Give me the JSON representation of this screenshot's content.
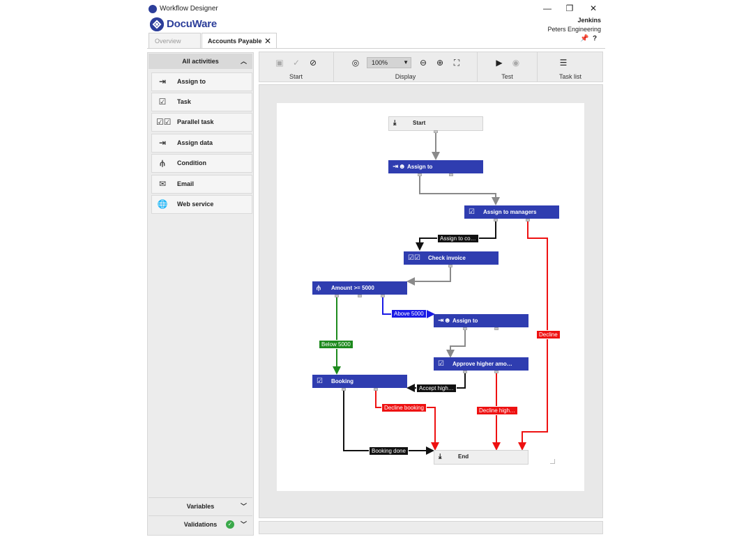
{
  "window": {
    "app_title": "Workflow Designer",
    "brand": "DocuWare",
    "user_name": "Jenkins",
    "user_org": "Peters Engineering",
    "controls": {
      "minimize": "—",
      "restore": "❐",
      "close": "✕"
    },
    "header_icons": {
      "pin": "📌",
      "help": "?"
    }
  },
  "tabs": [
    {
      "label": "Overview",
      "active": false
    },
    {
      "label": "Accounts Payable",
      "active": true
    }
  ],
  "sidebar": {
    "section_title": "All activities",
    "activities": [
      {
        "label": "Assign to",
        "icon": "assign-to-icon"
      },
      {
        "label": "Task",
        "icon": "task-icon"
      },
      {
        "label": "Parallel task",
        "icon": "parallel-task-icon"
      },
      {
        "label": "Assign data",
        "icon": "assign-data-icon"
      },
      {
        "label": "Condition",
        "icon": "condition-icon"
      },
      {
        "label": "Email",
        "icon": "email-icon"
      },
      {
        "label": "Web service",
        "icon": "web-service-icon"
      }
    ],
    "variables_label": "Variables",
    "validations_label": "Validations",
    "validations_status": "ok"
  },
  "toolbar": {
    "groups": [
      {
        "label": "Start"
      },
      {
        "label": "Display"
      },
      {
        "label": "Test"
      },
      {
        "label": "Task list"
      }
    ],
    "zoom": "100%"
  },
  "flow": {
    "nodes": {
      "start": "Start",
      "assign_to_1": "Assign to",
      "assign_to_managers": "Assign to managers",
      "check_invoice": "Check invoice",
      "amount_condition": "Amount >= 5000",
      "assign_to_2": "Assign to",
      "approve_higher": "Approve higher amo…",
      "booking": "Booking",
      "end": "End"
    },
    "edge_labels": {
      "assign_to_co": "Assign to co…",
      "above_5000": "Above 5000",
      "below_5000": "Below 5000",
      "decline": "Decline",
      "accept_high": "Accept high…",
      "decline_booking": "Decline booking",
      "decline_high": "Decline high…",
      "booking_done": "Booking done"
    },
    "colors": {
      "node": "#2f3db0",
      "default_edge": "#8a8a8a",
      "black_edge": "#111111",
      "blue_edge": "#1a1ae6",
      "green_edge": "#1d8a1d",
      "red_edge": "#ee1111"
    }
  }
}
